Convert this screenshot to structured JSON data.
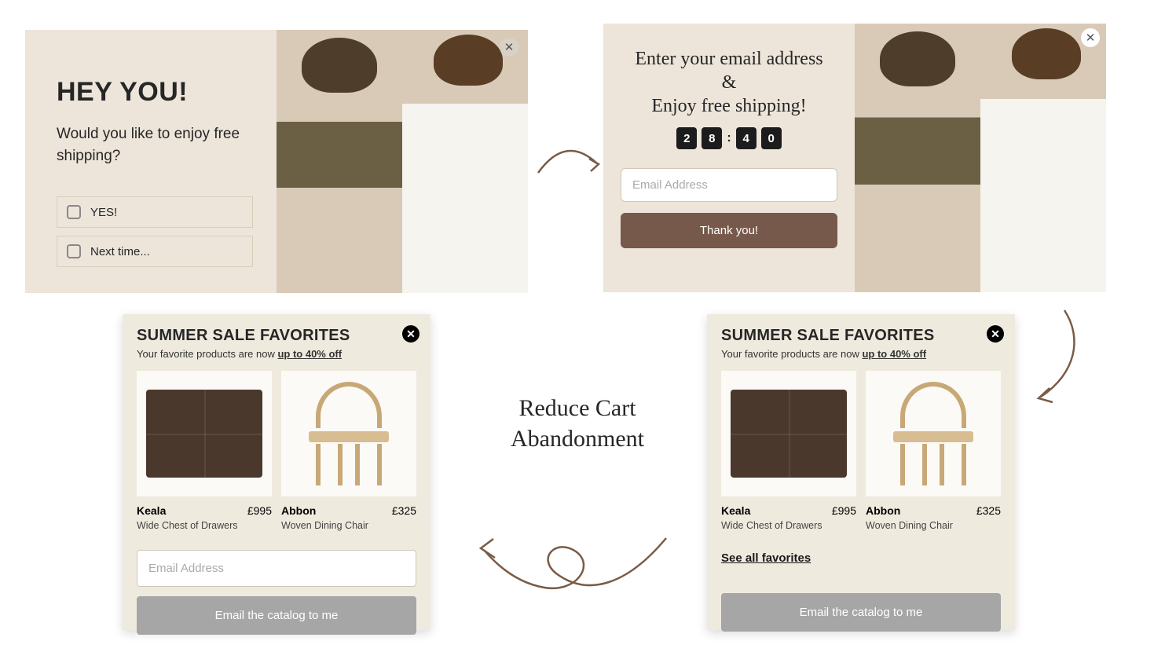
{
  "popup_a": {
    "title": "HEY YOU!",
    "question": "Would you like to enjoy free shipping?",
    "options": [
      "YES!",
      "Next time..."
    ]
  },
  "popup_b": {
    "headline": "Enter your email address\n&\nEnjoy free shipping!",
    "timer": {
      "m1": "2",
      "m2": "8",
      "s1": "4",
      "s2": "0"
    },
    "email_placeholder": "Email Address",
    "submit_label": "Thank you!"
  },
  "sale": {
    "title": "SUMMER SALE FAVORITES",
    "subtitle_prefix": "Your favorite products are now ",
    "subtitle_emph": "up to 40% off",
    "products": [
      {
        "name": "Keala",
        "price": "£995",
        "desc": "Wide Chest of Drawers"
      },
      {
        "name": "Abbon",
        "price": "£325",
        "desc": "Woven Dining Chair"
      }
    ],
    "see_all": "See all favorites",
    "email_placeholder": "Email Address",
    "catalog_btn": "Email the catalog to me"
  },
  "caption": "Reduce Cart Abandonment"
}
